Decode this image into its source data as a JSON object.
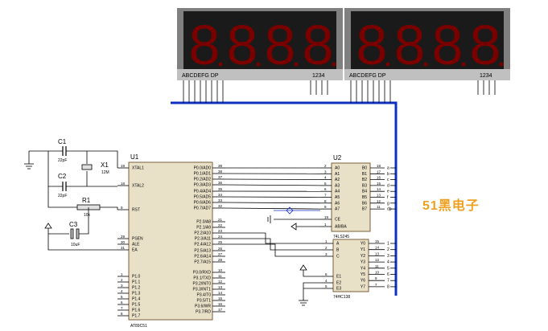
{
  "display": {
    "digit_glyph": "8",
    "seg_label": "ABCDEFG DP",
    "digit_label": "1234",
    "colors": {
      "frame": "#808080",
      "bg": "#1a1a1a",
      "seg": "#7a0000",
      "seg_dark": "#3a0000"
    }
  },
  "u1": {
    "ref": "U1",
    "part": "AT89C51",
    "left_pins": [
      {
        "num": "19",
        "name": "XTAL1"
      },
      {
        "num": "18",
        "name": "XTAL2"
      },
      {
        "num": "9",
        "name": "RST"
      },
      {
        "num": "29",
        "name": "PSEN"
      },
      {
        "num": "30",
        "name": "ALE"
      },
      {
        "num": "31",
        "name": "EA"
      },
      {
        "num": "1",
        "name": "P1.0"
      },
      {
        "num": "2",
        "name": "P1.1"
      },
      {
        "num": "3",
        "name": "P1.2"
      },
      {
        "num": "4",
        "name": "P1.3"
      },
      {
        "num": "5",
        "name": "P1.4"
      },
      {
        "num": "6",
        "name": "P1.5"
      },
      {
        "num": "7",
        "name": "P1.6"
      },
      {
        "num": "8",
        "name": "P1.7"
      }
    ],
    "right_pins": [
      {
        "num": "39",
        "name": "P0.0/AD0"
      },
      {
        "num": "38",
        "name": "P0.1/AD1"
      },
      {
        "num": "37",
        "name": "P0.2/AD2"
      },
      {
        "num": "36",
        "name": "P0.3/AD3"
      },
      {
        "num": "35",
        "name": "P0.4/AD4"
      },
      {
        "num": "34",
        "name": "P0.5/AD5"
      },
      {
        "num": "33",
        "name": "P0.6/AD6"
      },
      {
        "num": "32",
        "name": "P0.7/AD7"
      },
      {
        "num": "21",
        "name": "P2.0/A8"
      },
      {
        "num": "22",
        "name": "P2.1/A9"
      },
      {
        "num": "23",
        "name": "P2.2/A10"
      },
      {
        "num": "24",
        "name": "P2.3/A11"
      },
      {
        "num": "25",
        "name": "P2.4/A12"
      },
      {
        "num": "26",
        "name": "P2.5/A13"
      },
      {
        "num": "27",
        "name": "P2.6/A14"
      },
      {
        "num": "28",
        "name": "P2.7/A15"
      },
      {
        "num": "10",
        "name": "P3.0/RXD"
      },
      {
        "num": "11",
        "name": "P3.1/TXD"
      },
      {
        "num": "12",
        "name": "P3.2/INT0"
      },
      {
        "num": "13",
        "name": "P3.3/INT1"
      },
      {
        "num": "14",
        "name": "P3.4/T0"
      },
      {
        "num": "15",
        "name": "P3.5/T1"
      },
      {
        "num": "16",
        "name": "P3.6/WR"
      },
      {
        "num": "17",
        "name": "P3.7/RD"
      }
    ]
  },
  "u2": {
    "ref": "U2",
    "part": "74LS245",
    "a_pins": [
      {
        "num": "2",
        "name": "A0"
      },
      {
        "num": "3",
        "name": "A1"
      },
      {
        "num": "4",
        "name": "A2"
      },
      {
        "num": "5",
        "name": "A3"
      },
      {
        "num": "6",
        "name": "A4"
      },
      {
        "num": "7",
        "name": "A5"
      },
      {
        "num": "8",
        "name": "A6"
      },
      {
        "num": "9",
        "name": "A7"
      }
    ],
    "b_pins": [
      {
        "num": "18",
        "name": "B0",
        "net": "a"
      },
      {
        "num": "17",
        "name": "B1",
        "net": "b"
      },
      {
        "num": "16",
        "name": "B2",
        "net": "c"
      },
      {
        "num": "15",
        "name": "B3",
        "net": "d"
      },
      {
        "num": "14",
        "name": "B4",
        "net": "e"
      },
      {
        "num": "13",
        "name": "B5",
        "net": "f"
      },
      {
        "num": "12",
        "name": "B6",
        "net": "g"
      },
      {
        "num": "11",
        "name": "B7",
        "net": "dp"
      }
    ],
    "ctrl_pins": [
      {
        "num": "19",
        "name": "CE"
      },
      {
        "num": "1",
        "name": "AB/BA"
      }
    ]
  },
  "u3": {
    "part": "74HC138",
    "in_pins": [
      {
        "num": "1",
        "name": "A"
      },
      {
        "num": "2",
        "name": "B"
      },
      {
        "num": "3",
        "name": "C"
      },
      {
        "num": "6",
        "name": "E1"
      },
      {
        "num": "4",
        "name": "E2"
      },
      {
        "num": "5",
        "name": "E3"
      }
    ],
    "out_pins": [
      {
        "num": "15",
        "name": "Y0",
        "net": "1"
      },
      {
        "num": "14",
        "name": "Y1",
        "net": "2"
      },
      {
        "num": "13",
        "name": "Y2",
        "net": "3"
      },
      {
        "num": "12",
        "name": "Y3",
        "net": "4"
      },
      {
        "num": "11",
        "name": "Y4",
        "net": "5"
      },
      {
        "num": "10",
        "name": "Y5",
        "net": "6"
      },
      {
        "num": "9",
        "name": "Y6",
        "net": "7"
      },
      {
        "num": "7",
        "name": "Y7",
        "net": "8"
      }
    ]
  },
  "parts": {
    "c1": {
      "ref": "C1",
      "value": "22pF"
    },
    "c2": {
      "ref": "C2",
      "value": "22pF"
    },
    "x1": {
      "ref": "X1",
      "value": "12M"
    },
    "r1": {
      "ref": "R1",
      "value": "10k"
    },
    "c3": {
      "ref": "C3",
      "value": "10uF"
    }
  },
  "watermark": "51黑电子"
}
